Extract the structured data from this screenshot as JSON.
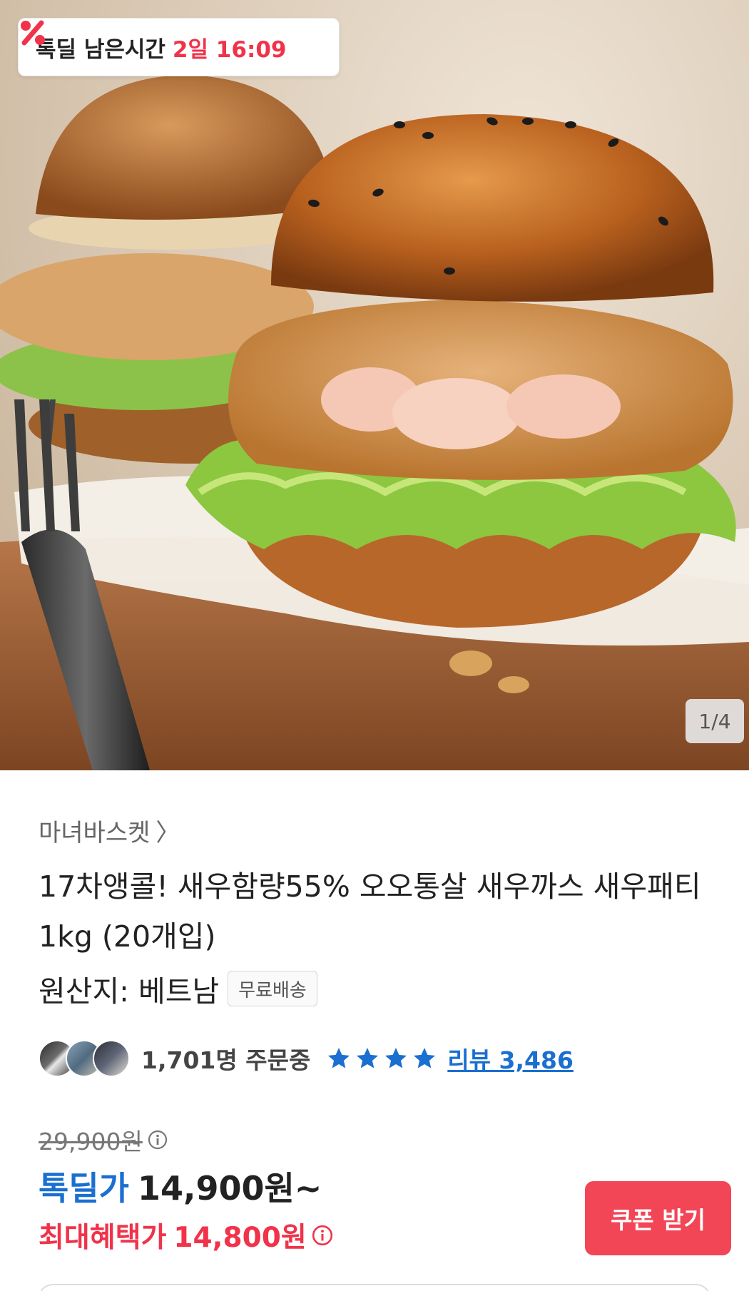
{
  "timer": {
    "label": "톡딜 남은시간",
    "time": "2일 16:09"
  },
  "gallery": {
    "counter": "1/4"
  },
  "product": {
    "seller": "마녀바스켓",
    "seller_chevron": "〉",
    "title": "17차앵콜! 새우함량55% 오오통살 새우까스 새우패티 1kg (20개입)",
    "origin": "원산지: 베트남",
    "shipping_badge": "무료배송"
  },
  "social": {
    "orders": "1,701명 주문중",
    "rating_stars": 4,
    "review_link": "리뷰 3,486"
  },
  "price": {
    "original": "29,900원",
    "deal_label": "톡딜가",
    "deal_price": "14,900원~",
    "max_label": "최대혜택가",
    "max_price": "14,800원"
  },
  "buttons": {
    "coupon": "쿠폰 받기"
  },
  "colors": {
    "accent_red": "#f0334a",
    "accent_blue": "#1a6fd0",
    "coupon_button": "#f24556"
  },
  "icons": [
    "discount-percent-icon",
    "chevron-right-icon",
    "star-icon",
    "info-icon"
  ]
}
